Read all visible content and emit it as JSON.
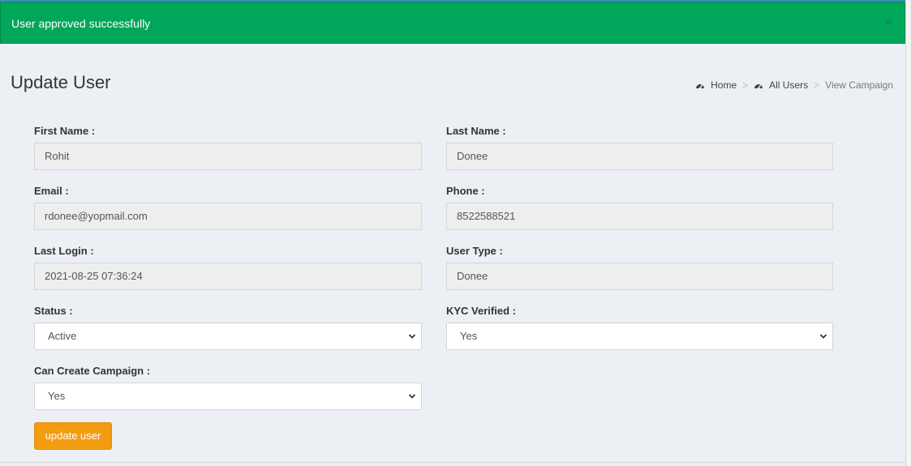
{
  "alert": {
    "message": "User approved successfully",
    "close_symbol": "×",
    "color": "#00a65a"
  },
  "page": {
    "title": "Update User"
  },
  "breadcrumb": {
    "home": "Home",
    "all_users": "All Users",
    "current": "View Campaign",
    "separator": ">"
  },
  "form": {
    "first_name": {
      "label": "First Name :",
      "value": "Rohit"
    },
    "last_name": {
      "label": "Last Name :",
      "value": "Donee"
    },
    "email": {
      "label": "Email :",
      "value": "rdonee@yopmail.com"
    },
    "phone": {
      "label": "Phone :",
      "value": "8522588521"
    },
    "last_login": {
      "label": "Last Login :",
      "value": "2021-08-25 07:36:24"
    },
    "user_type": {
      "label": "User Type :",
      "value": "Donee"
    },
    "status": {
      "label": "Status :",
      "value": "Active"
    },
    "kyc_verified": {
      "label": "KYC Verified :",
      "value": "Yes"
    },
    "can_create_campaign": {
      "label": "Can Create Campaign :",
      "value": "Yes"
    },
    "submit_label": "update user",
    "submit_color": "#f39c12"
  },
  "icons": {
    "breadcrumb_icon": "dashboard-gauge-icon",
    "select_arrow": "chevron-down-icon"
  }
}
